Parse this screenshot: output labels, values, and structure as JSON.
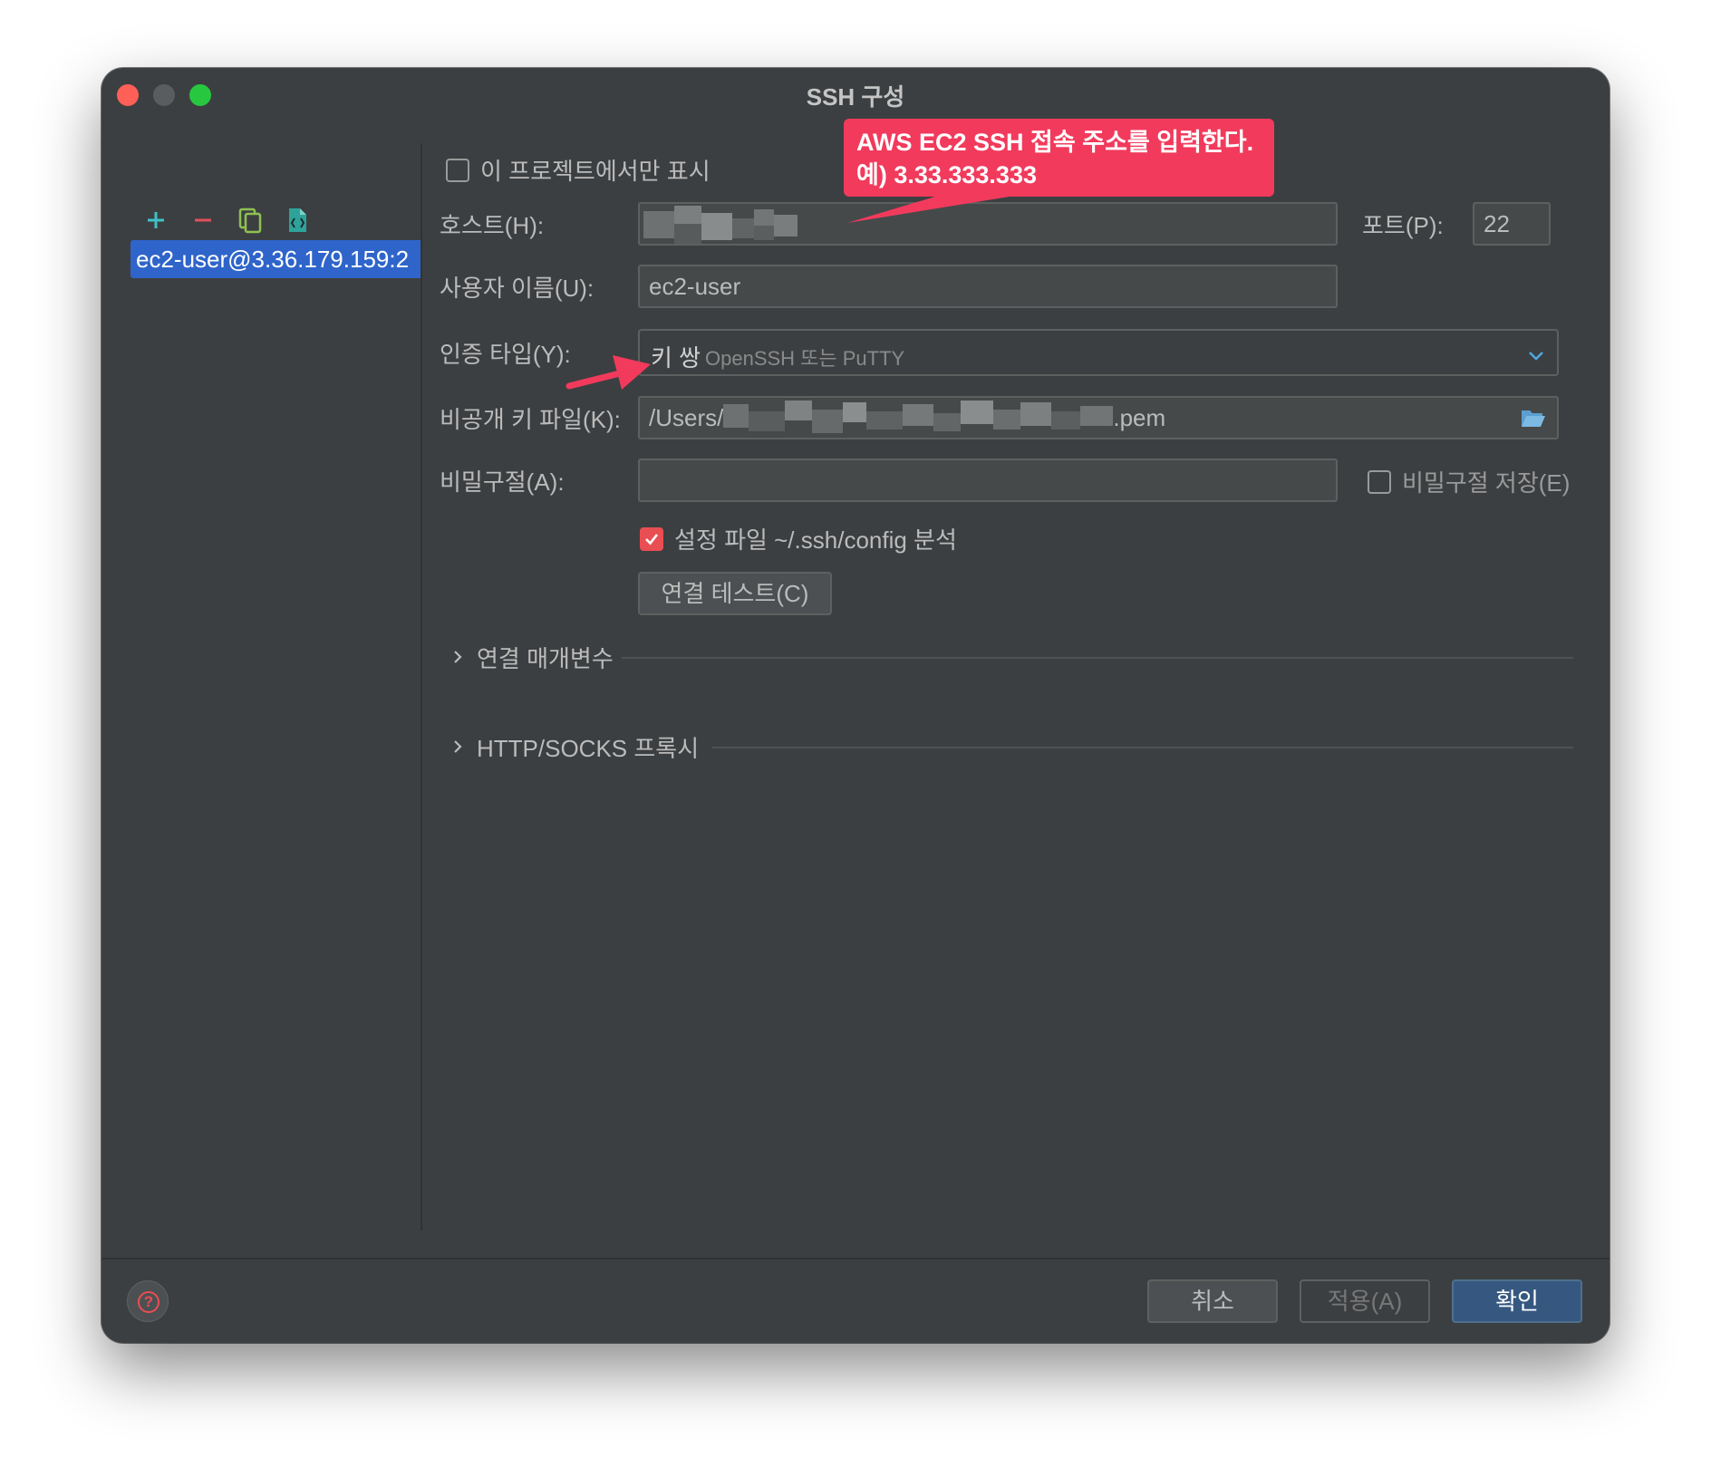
{
  "window": {
    "title": "SSH 구성"
  },
  "sidebar": {
    "toolbar": [
      "add-icon",
      "remove-icon",
      "copy-icon",
      "export-icon"
    ],
    "hosts": [
      {
        "label": "ec2-user@3.36.179.159:2"
      }
    ]
  },
  "form": {
    "only_project_label": "이 프로젝트에서만 표시",
    "host_label": "호스트(H):",
    "port_label": "포트(P):",
    "port_value": "22",
    "username_label": "사용자 이름(U):",
    "username_value": "ec2-user",
    "auth_label": "인증 타입(Y):",
    "auth_value": "키 쌍",
    "auth_hint": "OpenSSH 또는 PuTTY",
    "keyfile_label": "비공개 키 파일(K):",
    "keyfile_prefix": "/Users/",
    "keyfile_suffix": ".pem",
    "passphrase_label": "비밀구절(A):",
    "save_passphrase_label": "비밀구절 저장(E)",
    "parse_config_label": "설정 파일 ~/.ssh/config 분석",
    "parse_config_checked": true,
    "test_button": "연결 테스트(C)"
  },
  "sections": [
    {
      "label": "연결 매개변수"
    },
    {
      "label": "HTTP/SOCKS 프록시"
    }
  ],
  "footer": {
    "cancel": "취소",
    "apply": "적용(A)",
    "ok": "확인"
  },
  "annotation": {
    "line1": "AWS EC2 SSH 접속 주소를 입력한다.",
    "line2": "예) 3.33.333.333"
  },
  "colors": {
    "window_bg": "#3c3f41",
    "selection": "#2f65ca",
    "primary_button": "#365880",
    "annotation": "#f23a5c",
    "checkbox_checked": "#e94e53"
  }
}
